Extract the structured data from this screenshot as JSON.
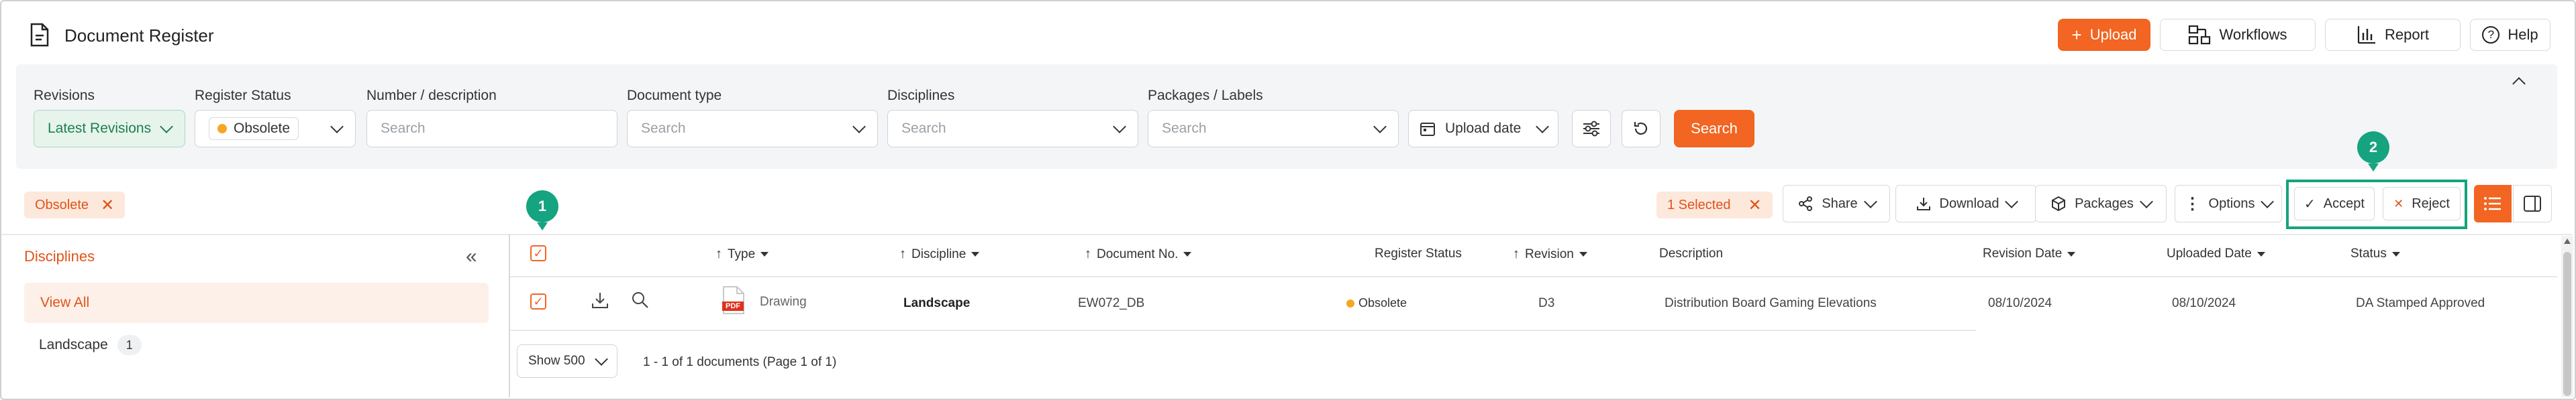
{
  "app": {
    "title": "Document Register"
  },
  "top_actions": {
    "upload": "Upload",
    "workflows": "Workflows",
    "report": "Report",
    "help": "Help"
  },
  "filters": {
    "revisions": {
      "label": "Revisions",
      "value": "Latest Revisions"
    },
    "register_status": {
      "label": "Register Status",
      "value": "Obsolete"
    },
    "number_description": {
      "label": "Number / description",
      "placeholder": "Search"
    },
    "document_type": {
      "label": "Document type",
      "placeholder": "Search"
    },
    "disciplines": {
      "label": "Disciplines",
      "placeholder": "Search"
    },
    "packages_labels": {
      "label": "Packages / Labels",
      "placeholder": "Search"
    },
    "upload_date": "Upload date",
    "search_button": "Search"
  },
  "active_filter_chip": "Obsolete",
  "selection": {
    "label": "1 Selected"
  },
  "toolbar": {
    "share": "Share",
    "download": "Download",
    "packages": "Packages",
    "options": "Options",
    "accept": "Accept",
    "reject": "Reject"
  },
  "markers": {
    "first": "1",
    "second": "2"
  },
  "sidebar": {
    "title": "Disciplines",
    "items": [
      {
        "label": "View All",
        "count": ""
      },
      {
        "label": "Landscape",
        "count": "1"
      }
    ]
  },
  "table": {
    "columns": [
      "Type",
      "Discipline",
      "Document No.",
      "Register Status",
      "Revision",
      "Description",
      "Revision Date",
      "Uploaded Date",
      "Status"
    ],
    "rows": [
      {
        "file_badge": "PDF",
        "type": "Drawing",
        "discipline": "Landscape",
        "document_no": "EW072_DB",
        "register_status": "Obsolete",
        "revision": "D3",
        "description": "Distribution Board Gaming Elevations",
        "revision_date": "08/10/2024",
        "uploaded_date": "08/10/2024",
        "status": "DA Stamped Approved"
      }
    ]
  },
  "footer": {
    "page_size": "Show 500",
    "summary": "1 - 1 of 1 documents (Page 1 of 1)"
  },
  "colors": {
    "accent": "#f26522",
    "marker": "#16a37f",
    "status_dot": "#f5a623",
    "revisions_bg": "#e6f4ec"
  }
}
